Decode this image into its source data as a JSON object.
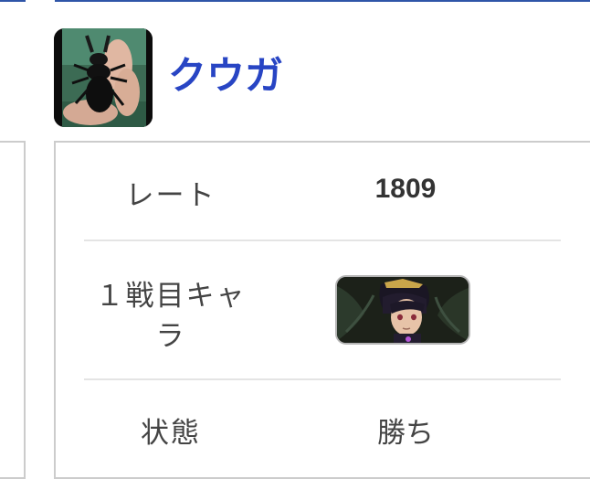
{
  "player": {
    "name": "クウガ"
  },
  "rows": {
    "rate": {
      "label": "レート",
      "value": "1809"
    },
    "character": {
      "label_line1": "１戦目キャ",
      "label_line2": "ラ"
    },
    "status": {
      "label": "状態",
      "value": "勝ち"
    }
  },
  "colors": {
    "accent": "#2845c4",
    "border": "#cccccc",
    "divider": "#e4e4e4",
    "top_rule": "#2f55a8"
  },
  "icons": {
    "avatar": "stag-beetle-photo",
    "character": "dark-pit-portrait"
  }
}
